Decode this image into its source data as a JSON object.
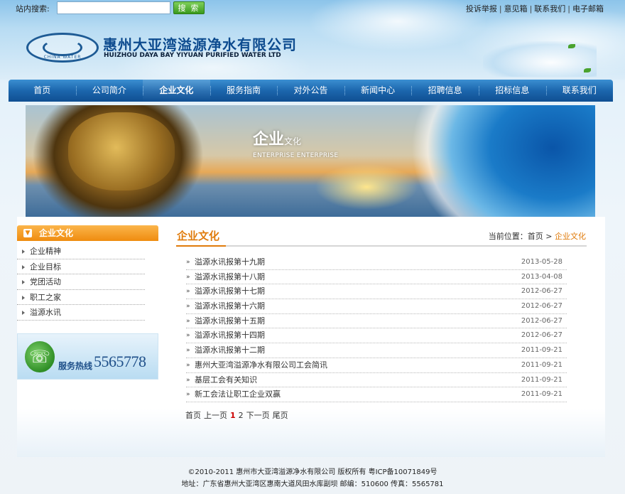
{
  "search": {
    "label": "站内搜索:",
    "placeholder": "",
    "button_label": "搜 索"
  },
  "top_links": [
    "投诉举报",
    "意见箱",
    "联系我们",
    "电子邮箱"
  ],
  "logo": {
    "company_cn": "惠州大亚湾溢源净水有限公司",
    "company_en": "HUIZHOU DAYA BAY YIYUAN PURIFIED WATER LTD",
    "emblem_text": "CHINA WATER"
  },
  "nav": {
    "items": [
      "首页",
      "公司简介",
      "企业文化",
      "服务指南",
      "对外公告",
      "新闻中心",
      "招聘信息",
      "招标信息",
      "联系我们"
    ],
    "active_index": 2
  },
  "banner": {
    "title_big": "企业",
    "title_small": "文化",
    "subtitle": "ENTERPRISE ENTERPRISE"
  },
  "sidebar": {
    "header": "企业文化",
    "items": [
      "企业精神",
      "企业目标",
      "党团活动",
      "职工之家",
      "溢源水讯"
    ],
    "hotline_label": "服务热线",
    "hotline_number": "5565778"
  },
  "main": {
    "title": "企业文化",
    "breadcrumb": {
      "prefix": "当前位置：",
      "home": "首页",
      "sep": ">",
      "current": "企业文化"
    },
    "news": [
      {
        "title": "溢源水讯报第十九期",
        "date": "2013-05-28"
      },
      {
        "title": "溢源水讯报第十八期",
        "date": "2013-04-08"
      },
      {
        "title": "溢源水讯报第十七期",
        "date": "2012-06-27"
      },
      {
        "title": "溢源水讯报第十六期",
        "date": "2012-06-27"
      },
      {
        "title": "溢源水讯报第十五期",
        "date": "2012-06-27"
      },
      {
        "title": "溢源水讯报第十四期",
        "date": "2012-06-27"
      },
      {
        "title": "溢源水讯报第十二期",
        "date": "2011-09-21"
      },
      {
        "title": "惠州大亚湾溢源净水有限公司工会简讯",
        "date": "2011-09-21"
      },
      {
        "title": "基层工会有关知识",
        "date": "2011-09-21"
      },
      {
        "title": "新工会法让职工企业双赢",
        "date": "2011-09-21"
      }
    ],
    "pager": {
      "first": "首页",
      "prev": "上一页",
      "page1": "1",
      "page2": "2",
      "next": "下一页",
      "last": "尾页"
    }
  },
  "footer": {
    "line1": "©2010-2011  惠州市大亚湾溢源净水有限公司  版权所有  粤ICP备10071849号",
    "line2": "地址：广东省惠州大亚湾区惠南大道风田水库副坝  邮编：510600  传真：5565781"
  },
  "colors": {
    "nav_blue": "#1c66ad",
    "accent_orange": "#e07b0b",
    "active_page_red": "#c00000"
  }
}
